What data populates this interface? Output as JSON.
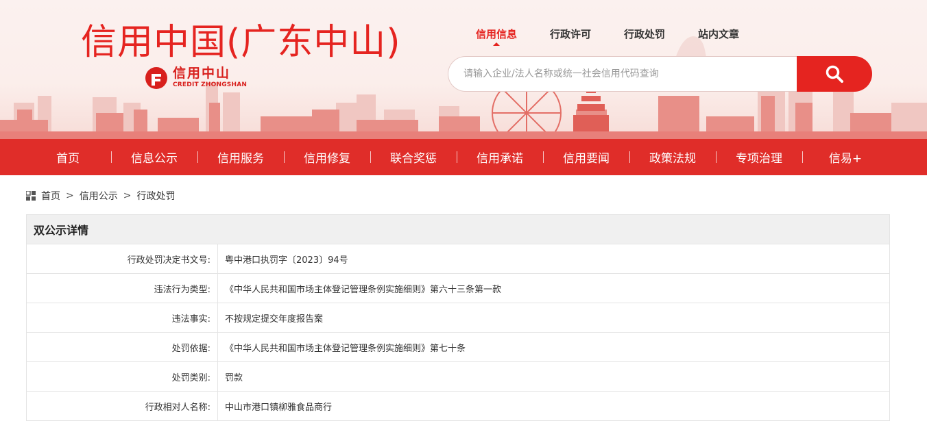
{
  "header": {
    "site_title": "信用中国(广东中山)",
    "logo_cn": "信用中山",
    "logo_en": "CREDIT ZHONGSHAN",
    "top_links": [
      "信用信息",
      "行政许可",
      "行政处罚",
      "站内文章"
    ],
    "active_top_link": "信用信息",
    "search": {
      "placeholder": "请输入企业/法人名称或统一社会信用代码查询",
      "value": ""
    },
    "brand_color": "#e52420"
  },
  "nav": {
    "items": [
      "首页",
      "信息公示",
      "信用服务",
      "信用修复",
      "联合奖惩",
      "信用承诺",
      "信用要闻",
      "政策法规",
      "专项治理",
      "信易+"
    ]
  },
  "breadcrumb": [
    "首页",
    "信用公示",
    "行政处罚"
  ],
  "detail": {
    "title": "双公示详情",
    "rows": [
      {
        "label": "行政处罚决定书文号:",
        "value": "粤中港口执罚字〔2023〕94号"
      },
      {
        "label": "违法行为类型:",
        "value": "《中华人民共和国市场主体登记管理条例实施细则》第六十三条第一款"
      },
      {
        "label": "违法事实:",
        "value": "不按规定提交年度报告案"
      },
      {
        "label": "处罚依据:",
        "value": "《中华人民共和国市场主体登记管理条例实施细则》第七十条"
      },
      {
        "label": "处罚类别:",
        "value": "罚款"
      },
      {
        "label": "行政相对人名称:",
        "value": "中山市港口镇柳雅食品商行"
      }
    ]
  }
}
